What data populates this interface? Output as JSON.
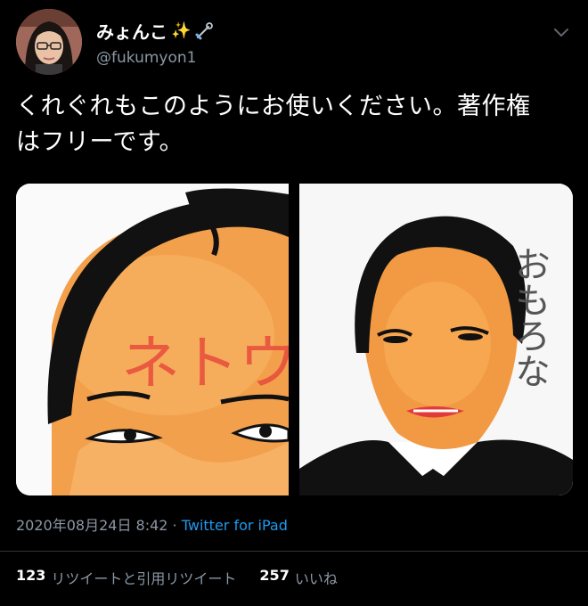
{
  "author": {
    "display_name": "みょんこ",
    "name_emoji": "✨",
    "pin_icon": "safety-pin-icon",
    "handle": "@fukumyon1"
  },
  "tweet": {
    "line1": "くれぐれもこのようにお使いください。著作権",
    "line2": "はフリーです。"
  },
  "media": {
    "left_image_text": "ネトウヨ",
    "right_image_text": "おもろな"
  },
  "meta": {
    "timestamp": "2020年08月24日 8:42",
    "separator": " · ",
    "source": "Twitter for iPad"
  },
  "stats": {
    "retweets_count": "123",
    "retweets_label": "リツイートと引用リツイート",
    "likes_count": "257",
    "likes_label": "いいね"
  },
  "colors": {
    "background": "#000000",
    "muted_text": "#8b98a5",
    "link": "#1d9bf0"
  }
}
